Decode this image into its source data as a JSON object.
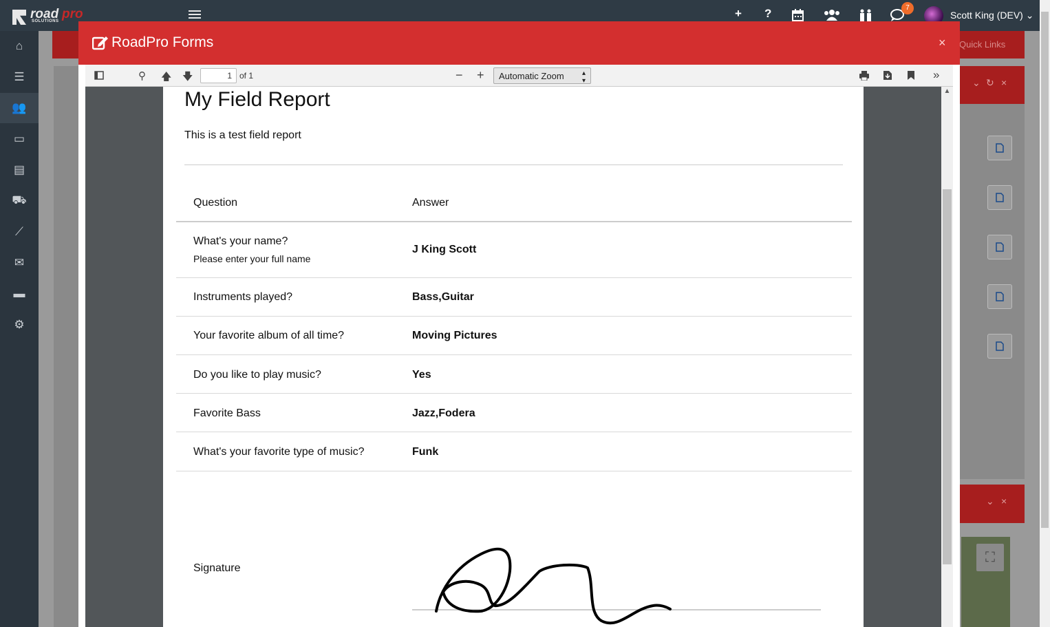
{
  "app": {
    "brand_road": "road",
    "brand_pro": "pro",
    "brand_sub": "SOLUTIONS",
    "user_name": "Scott King (DEV)",
    "notifications_count": "7",
    "quick_links": "Quick Links"
  },
  "modal": {
    "title": "RoadPro Forms",
    "close": "×"
  },
  "pdf_toolbar": {
    "page_value": "1",
    "page_of": "of 1",
    "zoom": "Automatic Zoom"
  },
  "report": {
    "title": "My Field Report",
    "subtitle": "This is a test field report",
    "header_question": "Question",
    "header_answer": "Answer",
    "rows": [
      {
        "question": "What's your name?",
        "hint": "Please enter your full name",
        "answer": "J King Scott"
      },
      {
        "question": "Instruments played?",
        "answer": "Bass,Guitar"
      },
      {
        "question": "Your favorite album of all time?",
        "answer": "Moving Pictures"
      },
      {
        "question": "Do you like to play music?",
        "answer": "Yes"
      },
      {
        "question": "Favorite Bass",
        "answer": "Jazz,Fodera"
      },
      {
        "question": "What's your favorite type of music?",
        "answer": "Funk"
      }
    ],
    "signature_label": "Signature"
  }
}
